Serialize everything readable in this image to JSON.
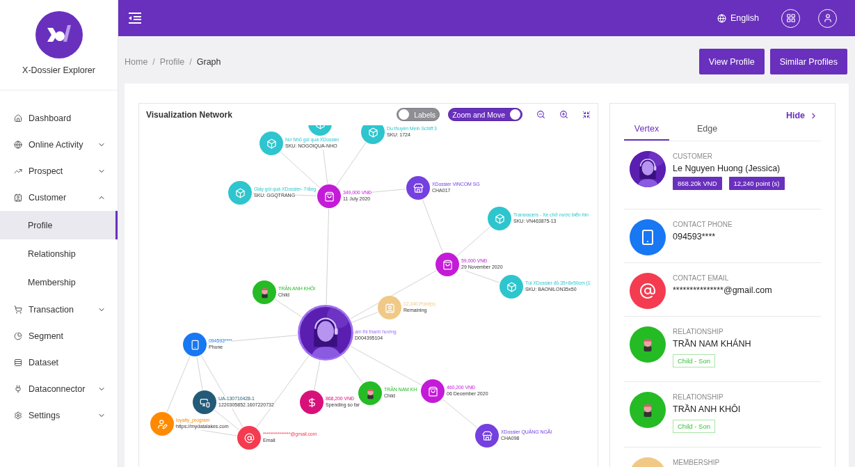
{
  "sidebar": {
    "brand": "X-Dossier Explorer",
    "items": [
      {
        "label": "Dashboard",
        "selected": false
      },
      {
        "label": "Online Activity",
        "selected": false,
        "expanded": false
      },
      {
        "label": "Prospect",
        "selected": false,
        "expanded": false
      },
      {
        "label": "Customer",
        "selected": false,
        "expanded": true,
        "children": [
          {
            "label": "Profile",
            "selected": true
          },
          {
            "label": "Relationship",
            "selected": false
          },
          {
            "label": "Membership",
            "selected": false
          }
        ]
      },
      {
        "label": "Transaction",
        "selected": false,
        "expanded": false
      },
      {
        "label": "Segment",
        "selected": false
      },
      {
        "label": "Dataset",
        "selected": false
      },
      {
        "label": "Dataconnector",
        "selected": false,
        "expanded": false
      },
      {
        "label": "Settings",
        "selected": false,
        "expanded": false
      }
    ]
  },
  "header": {
    "language": "English"
  },
  "breadcrumb": {
    "separator": "/",
    "items": [
      "Home",
      "Profile",
      "Graph"
    ]
  },
  "actions": [
    "View Profile",
    "Similar Profiles"
  ],
  "graph": {
    "title": "Visualization Network",
    "toggles": [
      {
        "label": "Labels",
        "on": false
      },
      {
        "label": "Zoom and Move",
        "on": true
      }
    ],
    "nodes": [
      {
        "kind": "product",
        "color": "#2ec5ce"
      },
      {
        "kind": "product",
        "color": "#2ec5ce",
        "title": "Nơ Nhỏ gói quà XDossier",
        "subtitle": "SKU: NOGOIQUA-NHO"
      },
      {
        "kind": "product",
        "color": "#2ec5ce",
        "title": "Du thuyền Mein Schiff 3",
        "subtitle": "SKU: 1724"
      },
      {
        "kind": "product",
        "color": "#2ec5ce",
        "title": "Giấy gói quà XDossier- Trắng",
        "subtitle": "SKU: GGQTRANG"
      },
      {
        "kind": "order",
        "color": "#c41bd8",
        "title": "349,000 VNĐ",
        "subtitle": "11 July 2020"
      },
      {
        "kind": "store",
        "color": "#7440e0",
        "title": "XDossier VINCOM SG",
        "subtitle": "CHA017"
      },
      {
        "kind": "product",
        "color": "#2ec5ce",
        "title": "Transracers - Xe chở nước biển hìn",
        "subtitle": "SKU: VN463875-13"
      },
      {
        "kind": "order",
        "color": "#c41bd8",
        "title": "59,000 VNĐ",
        "subtitle": "29 November 2020"
      },
      {
        "kind": "product",
        "color": "#2ec5ce",
        "title": "Túi XDossier đỏ 35+8x50cm (1",
        "subtitle": "SKU: BAONILON35x50"
      },
      {
        "kind": "child",
        "color": "#25bb25",
        "title": "TRẦN ANH KHÔI",
        "subtitle": "Child"
      },
      {
        "kind": "customer",
        "color": "#a070f0",
        "title": "ạm thi thanh hương",
        "subtitle": "D004395104"
      },
      {
        "kind": "membership",
        "color": "#f0c987",
        "title": "12,240 Point(s)",
        "subtitle": "Remaining"
      },
      {
        "kind": "phone",
        "color": "#1877f2",
        "title": "094593****",
        "subtitle": "Phone"
      },
      {
        "kind": "device",
        "color": "#235a78",
        "title": "UA-130710428-1",
        "subtitle": "1220305852.1607220732"
      },
      {
        "kind": "spending",
        "color": "#d8117a",
        "title": "868,200 VNĐ",
        "subtitle": "Spending so far"
      },
      {
        "kind": "child",
        "color": "#25bb25",
        "title": "TRẦN NAM KH",
        "subtitle": "Child"
      },
      {
        "kind": "order",
        "color": "#c41bd8",
        "title": "460,200 VNĐ",
        "subtitle": "06 December 2020"
      },
      {
        "kind": "store",
        "color": "#7440e0",
        "title": "XDossier QUẢNG NGÃI",
        "subtitle": "CHA098"
      },
      {
        "kind": "loyalty",
        "color": "#ff8a00",
        "title": "loyalty_program",
        "subtitle": "https://mydatalakes.com"
      },
      {
        "kind": "email",
        "color": "#f43b50",
        "title": "***************@gmail.com",
        "subtitle": "Email"
      }
    ]
  },
  "panel": {
    "hide": "Hide",
    "tabs": [
      {
        "label": "Vertex",
        "selected": true
      },
      {
        "label": "Edge",
        "selected": false
      }
    ],
    "entries": [
      {
        "kind": "customer",
        "color": "#5a1fb0",
        "label": "CUSTOMER",
        "value": "Le Nguyen Huong (Jessica)",
        "badges": [
          "868.20k VND",
          "12,240 point (s)"
        ]
      },
      {
        "kind": "phone",
        "color": "#1877f2",
        "label": "CONTACT PHONE",
        "value": "094593****"
      },
      {
        "kind": "email",
        "color": "#f43b50",
        "label": "CONTACT EMAIL",
        "value": "***************@gmail.com"
      },
      {
        "kind": "relationship",
        "color": "#25bb25",
        "label": "RELATIONSHIP",
        "value": "TRẦN NAM KHÁNH",
        "tag": "Child - Son"
      },
      {
        "kind": "relationship",
        "color": "#25bb25",
        "label": "RELATIONSHIP",
        "value": "TRẦN ANH KHÔI",
        "tag": "Child - Son"
      },
      {
        "kind": "membership",
        "color": "#f0c987",
        "label": "MEMBERSHIP"
      }
    ]
  }
}
